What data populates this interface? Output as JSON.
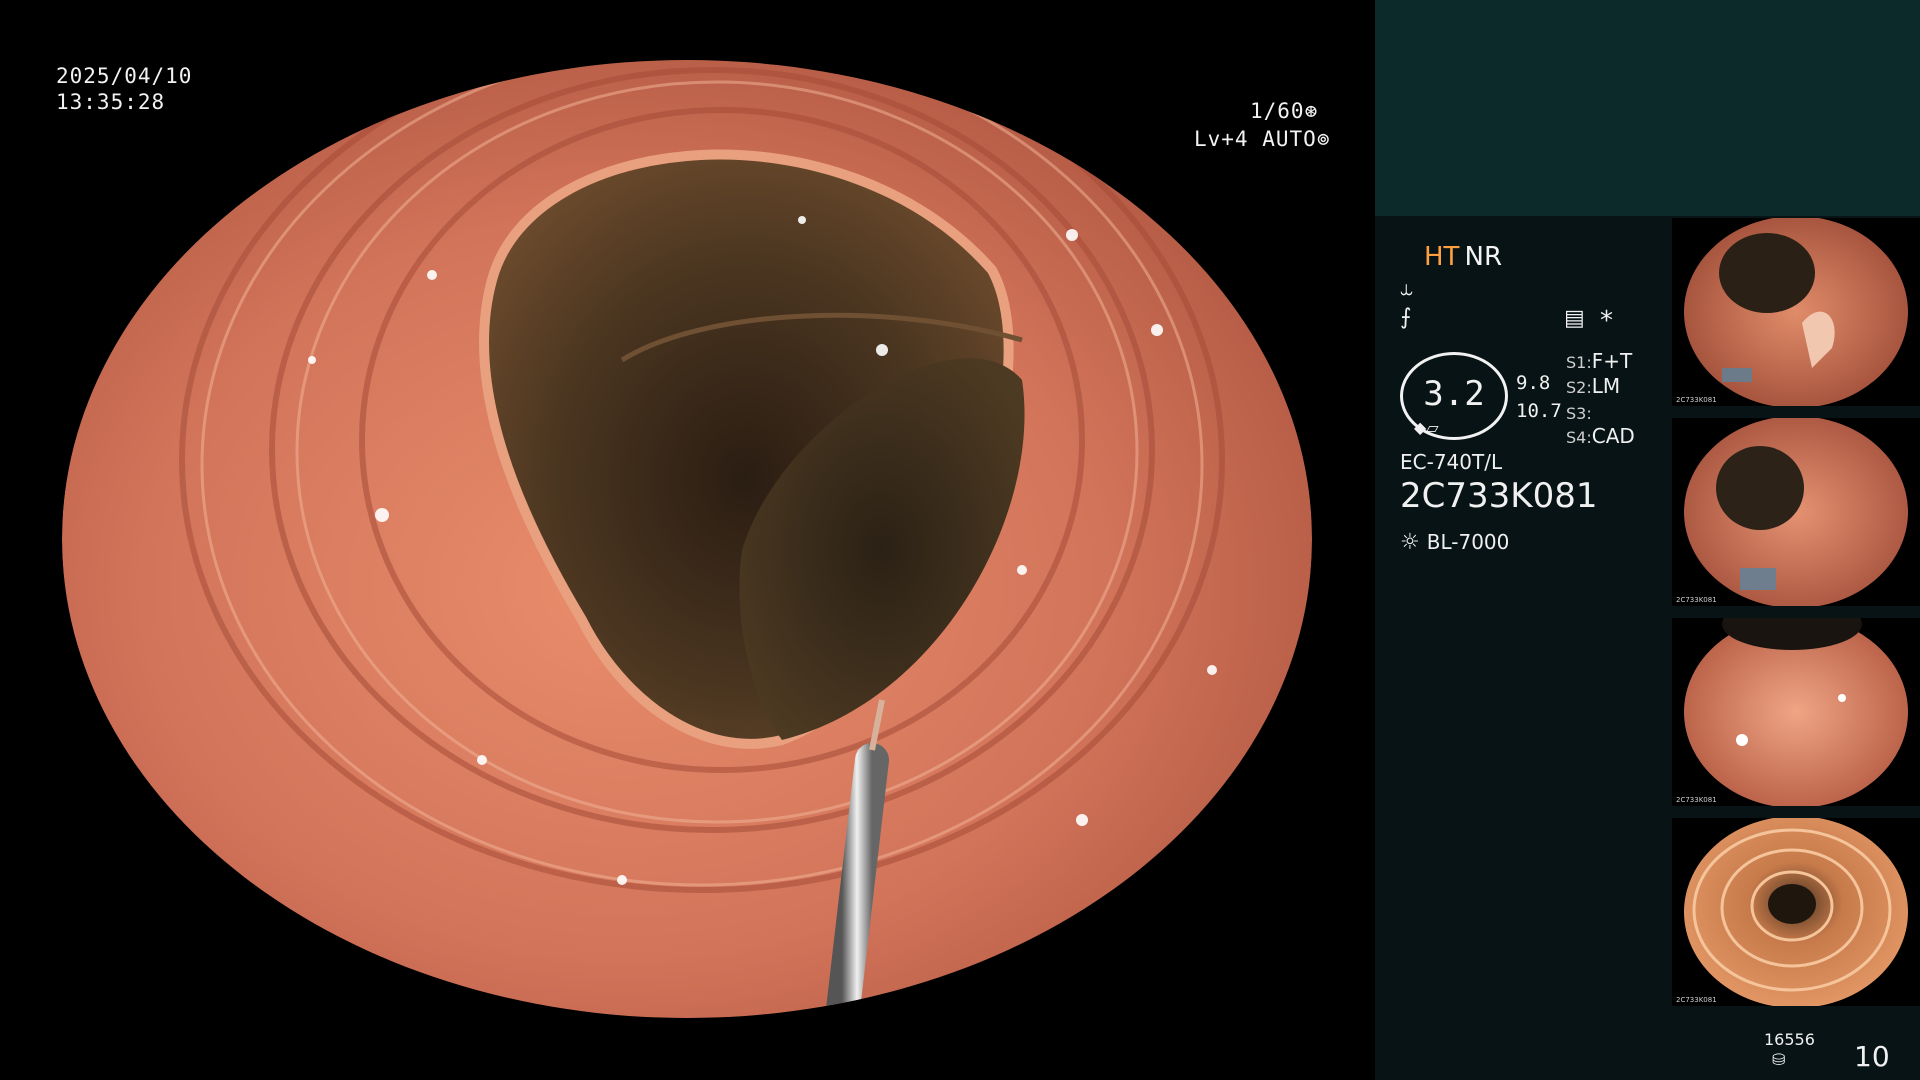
{
  "overlay": {
    "date": "2025/04/10",
    "time": "13:35:28",
    "shutter": "1/60",
    "level": "Lv+4",
    "mode": "AUTO"
  },
  "panel": {
    "mode_ht": "HT",
    "mode_nr": "NR",
    "gauge_value": "3.2",
    "value_a": "9.8",
    "value_b": "10.7",
    "star": "*",
    "slots": [
      {
        "label": "S1:",
        "value": "F+T"
      },
      {
        "label": "S2:",
        "value": "LM"
      },
      {
        "label": "S3:",
        "value": ""
      },
      {
        "label": "S4:",
        "value": "CAD"
      }
    ],
    "scope_model": "EC-740T/L",
    "serial": "2C733K081",
    "light_source": "BL-7000",
    "storage_count": "16556",
    "image_count": "10"
  },
  "thumbnails": [
    {
      "caption": "2C733K081"
    },
    {
      "caption": "2C733K081"
    },
    {
      "caption": "2C733K081"
    },
    {
      "caption": "2C733K081"
    }
  ],
  "colors": {
    "panel_top": "#0d2a2b",
    "panel_main": "#071314",
    "ht_accent": "#ffa040",
    "mucosa": "#d9785a"
  }
}
